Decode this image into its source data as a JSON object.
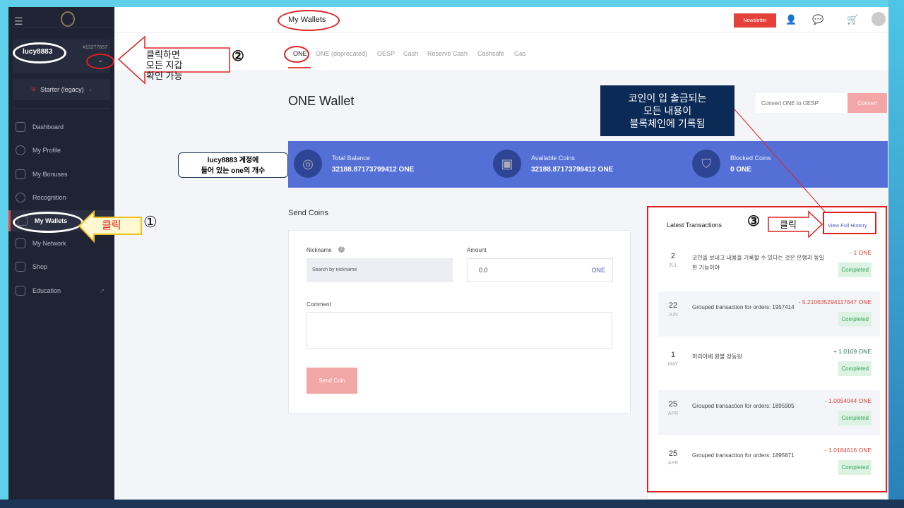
{
  "header": {
    "title": "My Wallets",
    "newsletter": "Newsletter"
  },
  "user": {
    "name": "lucy8883",
    "id": "#13277857",
    "rank": "Starter (legacy)"
  },
  "sidebar": {
    "items": [
      {
        "label": "Dashboard"
      },
      {
        "label": "My Profile"
      },
      {
        "label": "My Bonuses"
      },
      {
        "label": "Recognition"
      },
      {
        "label": "My Wallets"
      },
      {
        "label": "My Network"
      },
      {
        "label": "Shop"
      },
      {
        "label": "Education"
      }
    ]
  },
  "tabs": [
    "ONE",
    "ONE (deprecated)",
    "OESP",
    "Cash",
    "Reserve Cash",
    "Cashsafe",
    "Gas"
  ],
  "wallet": {
    "title": "ONE Wallet",
    "convert_placeholder": "Convert ONE to OESP",
    "convert_button": "Convert",
    "total_label": "Total Balance",
    "total": "32188.87173799412 ONE",
    "available_label": "Available Coins",
    "available": "32188.87173799412 ONE",
    "blocked_label": "Blocked Coins",
    "blocked": "0 ONE"
  },
  "send": {
    "title": "Send Coins",
    "nickname_label": "Nickname",
    "nickname_placeholder": "Search by nickname",
    "amount_label": "Amount",
    "amount_value": "0.0",
    "amount_unit": "ONE",
    "comment_label": "Comment",
    "button": "Send Coin"
  },
  "transactions": {
    "title": "Latest Transactions",
    "view_all": "View Full History",
    "items": [
      {
        "day": "2",
        "month": "JUL",
        "desc": "코인을 보내고 내용을 기록할 수 있다는 것은 은행과 동일한 기능이야",
        "amount": "- 1 ONE",
        "status": "Completed"
      },
      {
        "day": "22",
        "month": "JUN",
        "desc": "Grouped transaction for orders: 1957414",
        "amount": "- 5.210635294117647 ONE",
        "status": "Completed"
      },
      {
        "day": "1",
        "month": "MAY",
        "desc": "허리아베 환불 강동원",
        "amount": "+ 1.0109 ONE",
        "status": "Completed"
      },
      {
        "day": "25",
        "month": "APR",
        "desc": "Grouped transaction for orders: 1895905",
        "amount": "- 1.0054044 ONE",
        "status": "Completed"
      },
      {
        "day": "25",
        "month": "APR",
        "desc": "Grouped transaction for orders: 1895871",
        "amount": "- 1.0184616 ONE",
        "status": "Completed"
      }
    ]
  },
  "annotations": {
    "a1_text": "클릭",
    "a1_num": "①",
    "a2_text": "클릭하면\n모든 지갑\n확인 가능",
    "a2_num": "②",
    "a3_text": "클릭",
    "a3_num": "③",
    "balance_note": "lucy8883 계정에\n들어 있는 one의 개수",
    "blockchain_note": "코인이 입 출금되는\n모든 내용이\n블록체인에 기록됨"
  }
}
